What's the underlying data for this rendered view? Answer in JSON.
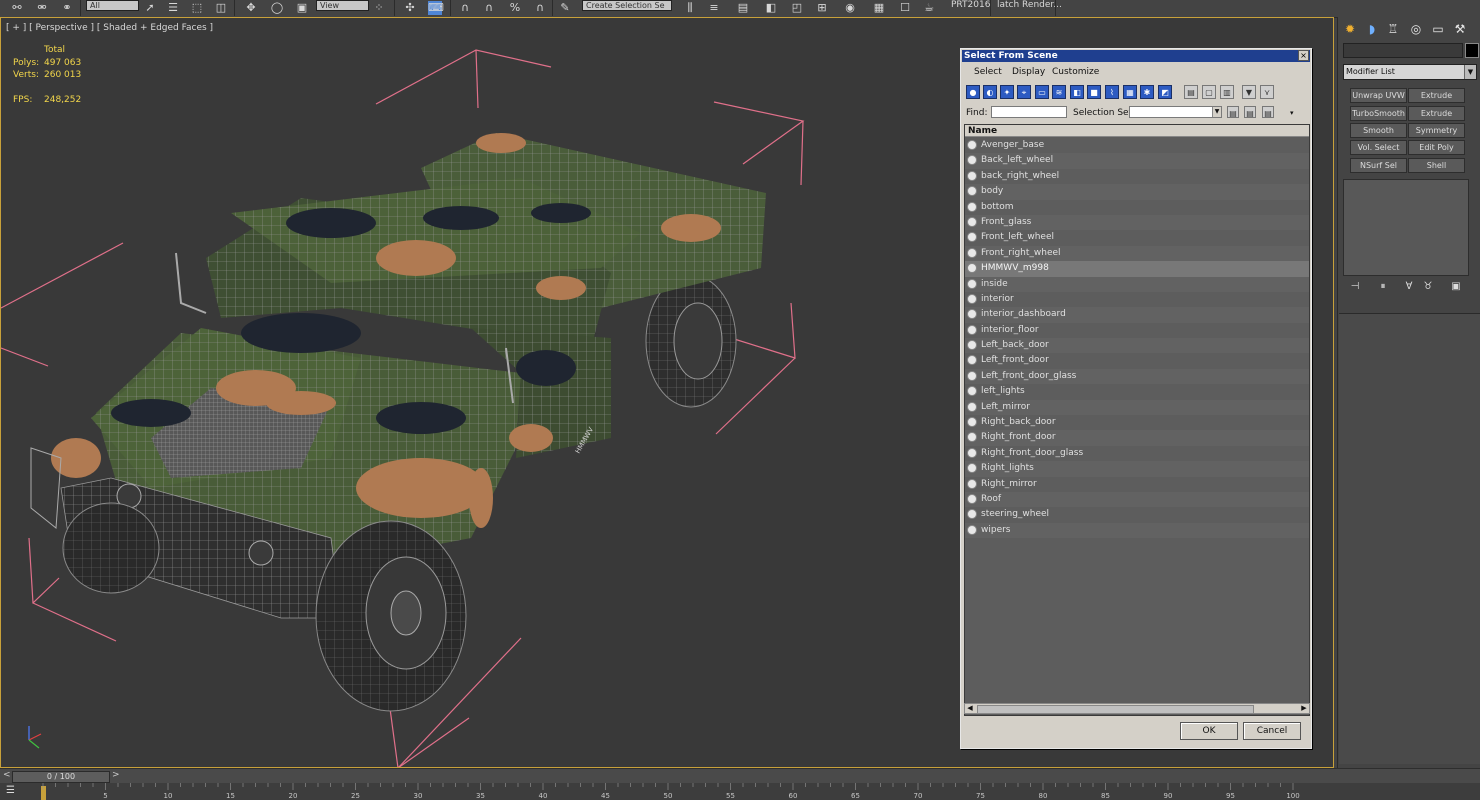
{
  "toolbar": {
    "layer_combo": "All",
    "view_combo": "View",
    "selection_set_combo": "Create Selection Se",
    "label_prt": "PRT2016",
    "label_batch": "latch Render..."
  },
  "viewport": {
    "label": "[ + ] [ Perspective ] [ Shaded + Edged Faces ]",
    "stats": {
      "total_label": "Total",
      "polys_label": "Polys:",
      "polys_value": "497 063",
      "verts_label": "Verts:",
      "verts_value": "260 013",
      "fps_label": "FPS:",
      "fps_value": "248,252"
    },
    "hood_decal": "HMMWV"
  },
  "timeline": {
    "position": "0 / 100",
    "ticks": [
      "0",
      "5",
      "10",
      "15",
      "20",
      "25",
      "30",
      "35",
      "40",
      "45",
      "50",
      "55",
      "60",
      "65",
      "70",
      "75",
      "80",
      "85",
      "90",
      "95",
      "100"
    ]
  },
  "command_panel": {
    "modifier_list": "Modifier List",
    "modifiers": [
      "Unwrap UVW",
      "Extrude",
      "TurboSmooth",
      "Extrude",
      "Smooth",
      "Symmetry",
      "Vol. Select",
      "Edit Poly",
      "NSurf Sel",
      "Shell"
    ]
  },
  "dialog": {
    "title": "Select From Scene",
    "close": "×",
    "menu": [
      "Select",
      "Display",
      "Customize"
    ],
    "find_label": "Find:",
    "selection_set_label": "Selection Set:",
    "column_header": "Name",
    "items": [
      "Avenger_base",
      "Back_left_wheel",
      "back_right_wheel",
      "body",
      "bottom",
      "Front_glass",
      "Front_left_wheel",
      "Front_right_wheel",
      "HMMWV_m998",
      "inside",
      "interior",
      "interior_dashboard",
      "interior_floor",
      "Left_back_door",
      "Left_front_door",
      "Left_front_door_glass",
      "left_lights",
      "Left_mirror",
      "Right_back_door",
      "Right_front_door",
      "Right_front_door_glass",
      "Right_lights",
      "Right_mirror",
      "Roof",
      "steering_wheel",
      "wipers"
    ],
    "selected_item": "HMMWV_m998",
    "ok_label": "OK",
    "cancel_label": "Cancel"
  }
}
